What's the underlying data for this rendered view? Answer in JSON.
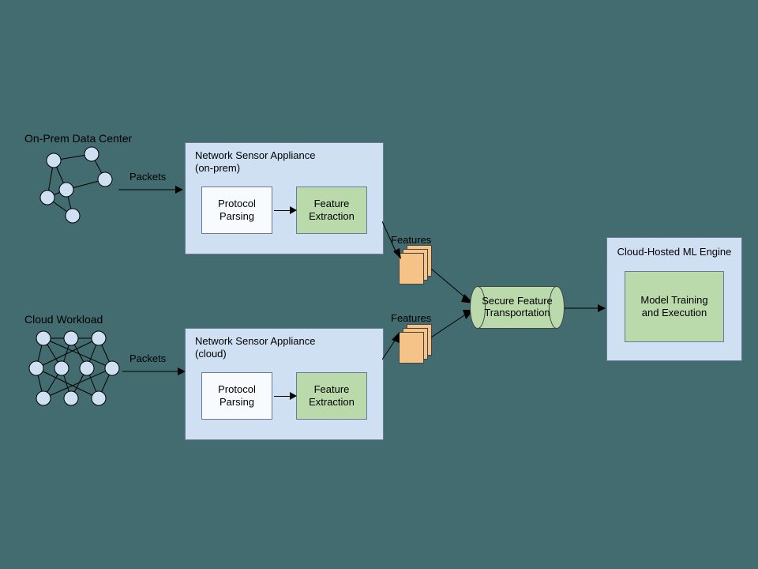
{
  "titles": {
    "onprem": "On-Prem Data Center",
    "cloud": "Cloud Workload"
  },
  "edges": {
    "packets": "Packets",
    "features": "Features"
  },
  "appliance_onprem": {
    "title": "Network Sensor Appliance\n(on-prem)",
    "protocol": "Protocol\nParsing",
    "feature": "Feature\nExtraction"
  },
  "appliance_cloud": {
    "title": "Network Sensor Appliance\n(cloud)",
    "protocol": "Protocol\nParsing",
    "feature": "Feature\nExtraction"
  },
  "transport": "Secure Feature\nTransportation",
  "ml": {
    "title": "Cloud-Hosted ML Engine",
    "box": "Model Training\nand Execution"
  }
}
